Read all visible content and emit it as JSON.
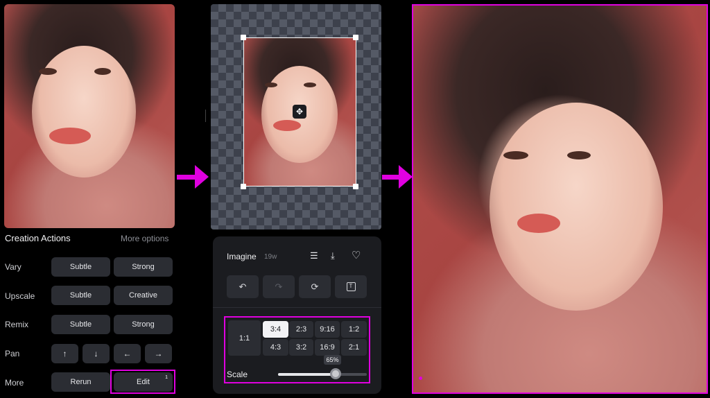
{
  "creation_actions": {
    "title": "Creation Actions",
    "more_options": "More options",
    "rows": [
      {
        "label": "Vary",
        "buttons": [
          "Subtle",
          "Strong"
        ]
      },
      {
        "label": "Upscale",
        "buttons": [
          "Subtle",
          "Creative"
        ]
      },
      {
        "label": "Remix",
        "buttons": [
          "Subtle",
          "Strong"
        ]
      },
      {
        "label": "Pan",
        "buttons": [
          "↑",
          "↓",
          "←",
          "→"
        ]
      },
      {
        "label": "More",
        "buttons": [
          "Rerun",
          "Edit"
        ]
      }
    ],
    "edit_badge": "1"
  },
  "editor": {
    "move_icon": "move-arrows-icon",
    "panel": {
      "title": "Imagine",
      "time": "19w",
      "header_icons": [
        "list-icon",
        "download-icon",
        "heart-icon"
      ],
      "tools": [
        {
          "icon": "undo-icon",
          "glyph": "↶",
          "enabled": true
        },
        {
          "icon": "redo-icon",
          "glyph": "↷",
          "enabled": false
        },
        {
          "icon": "refresh-icon",
          "glyph": "⟳",
          "enabled": true
        },
        {
          "icon": "text-box-icon",
          "glyph": "T",
          "enabled": true
        }
      ]
    },
    "aspect_ratios": {
      "large": "1:1",
      "options": [
        "3:4",
        "2:3",
        "9:16",
        "1:2",
        "4:3",
        "3:2",
        "16:9",
        "2:1"
      ],
      "selected": "3:4"
    },
    "scale": {
      "label": "Scale",
      "value_label": "65%",
      "value": 0.65
    }
  },
  "highlight_color": "#e000e0"
}
